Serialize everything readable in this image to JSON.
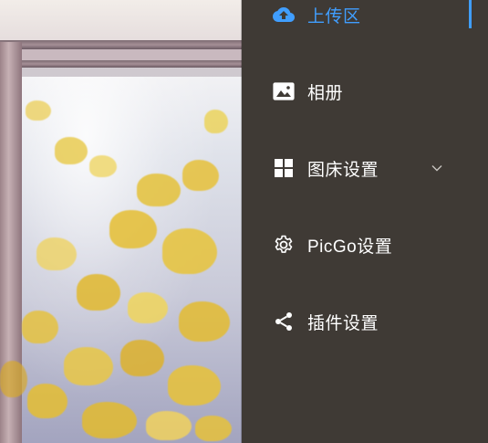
{
  "menu": {
    "items": [
      {
        "label": "上传区",
        "icon": "upload-cloud-icon",
        "active": true
      },
      {
        "label": "相册",
        "icon": "image-icon",
        "active": false
      },
      {
        "label": "图床设置",
        "icon": "grid-icon",
        "active": false,
        "expandable": true
      },
      {
        "label": "PicGo设置",
        "icon": "gear-icon",
        "active": false
      },
      {
        "label": "插件设置",
        "icon": "share-icon",
        "active": false
      }
    ]
  },
  "colors": {
    "sidebar_bg": "#3f3a35",
    "active_accent": "#409eff",
    "text": "#ffffff"
  }
}
